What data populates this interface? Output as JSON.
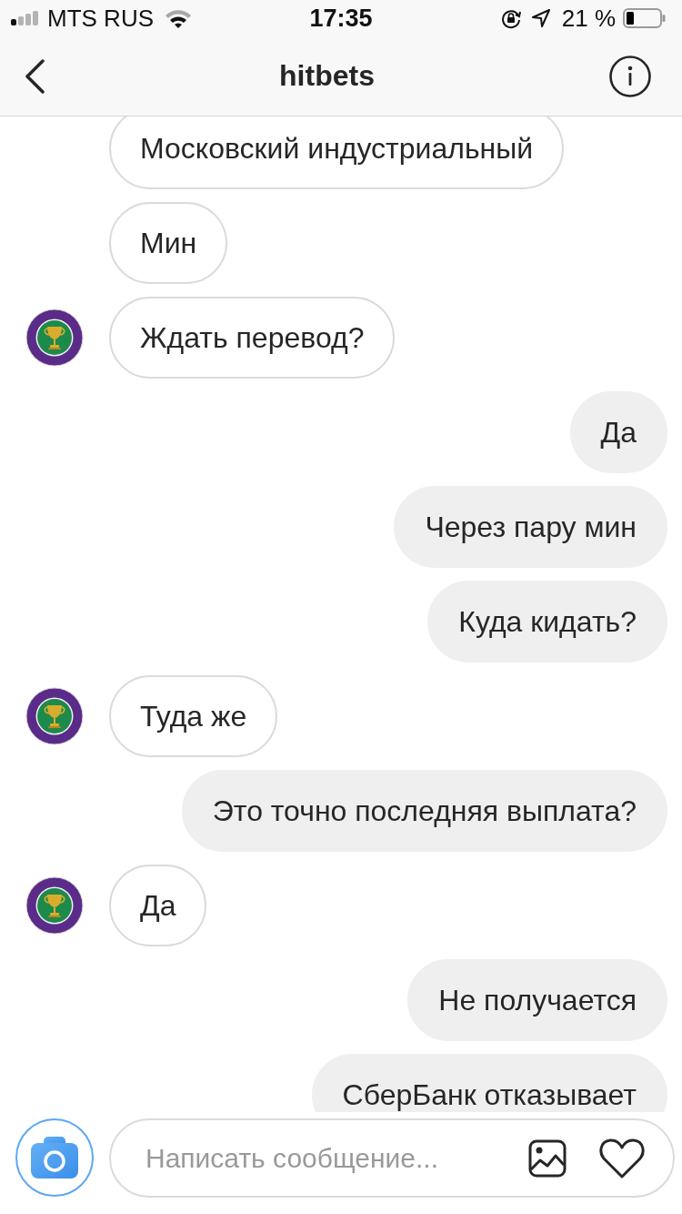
{
  "status_bar": {
    "carrier": "MTS RUS",
    "time": "17:35",
    "battery": "21 %"
  },
  "header": {
    "title": "hitbets"
  },
  "messages": [
    {
      "kind": "incoming",
      "text": "Московский индустриальный",
      "avatar": false
    },
    {
      "kind": "incoming",
      "text": "Мин",
      "avatar": false
    },
    {
      "kind": "incoming",
      "text": "Ждать перевод?",
      "avatar": true
    },
    {
      "kind": "outgoing",
      "text": "Да"
    },
    {
      "kind": "outgoing",
      "text": "Через пару мин"
    },
    {
      "kind": "outgoing",
      "text": "Куда кидать?"
    },
    {
      "kind": "incoming",
      "text": "Туда же",
      "avatar": true
    },
    {
      "kind": "outgoing",
      "text": "Это точно последняя выплата?"
    },
    {
      "kind": "incoming",
      "text": "Да",
      "avatar": true
    },
    {
      "kind": "outgoing",
      "text": "Не получается"
    },
    {
      "kind": "outgoing",
      "text": "СберБанк отказывает"
    }
  ],
  "composer": {
    "placeholder": "Написать сообщение..."
  }
}
